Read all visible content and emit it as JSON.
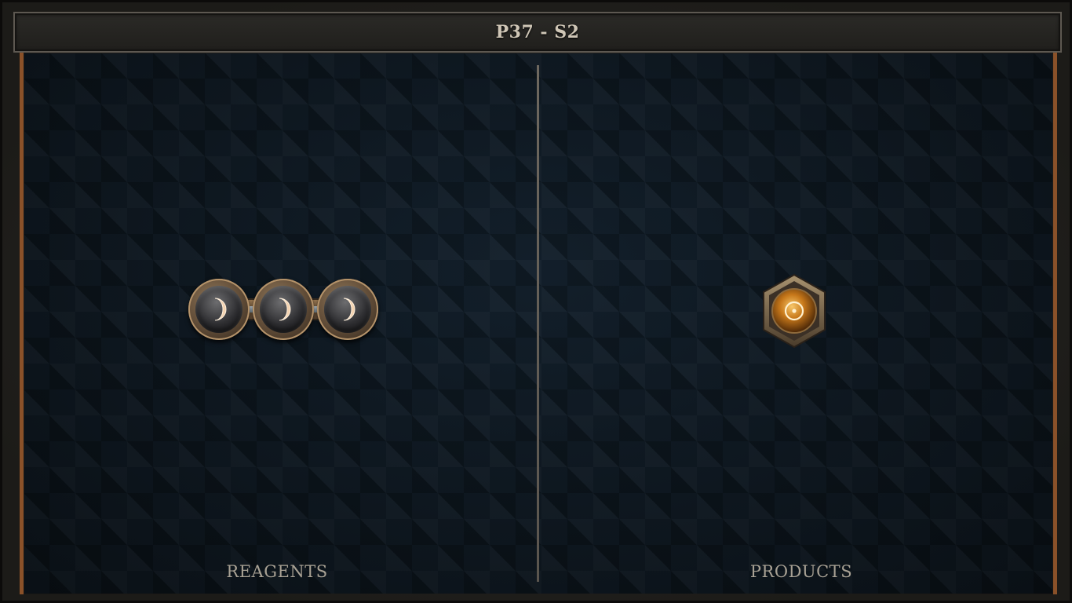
{
  "header": {
    "title": "P37 - S2"
  },
  "panels": {
    "left": {
      "label": "REAGENTS"
    },
    "right": {
      "label": "PRODUCTS"
    }
  },
  "reagents": {
    "atoms": [
      {
        "symbol_icon": "crescent-moon-icon",
        "glow_color": "#f3d2b0"
      },
      {
        "symbol_icon": "crescent-moon-icon",
        "glow_color": "#f3d2b0"
      },
      {
        "symbol_icon": "crescent-moon-icon",
        "glow_color": "#f3d2b0"
      }
    ],
    "bonds": 2
  },
  "products": {
    "atoms": [
      {
        "symbol_icon": "sun-circle-icon",
        "color": "#d98a1e"
      }
    ]
  },
  "colors": {
    "board_bg": "#121d27",
    "accent_copper": "#8a5129",
    "label_text": "#a8a194"
  }
}
